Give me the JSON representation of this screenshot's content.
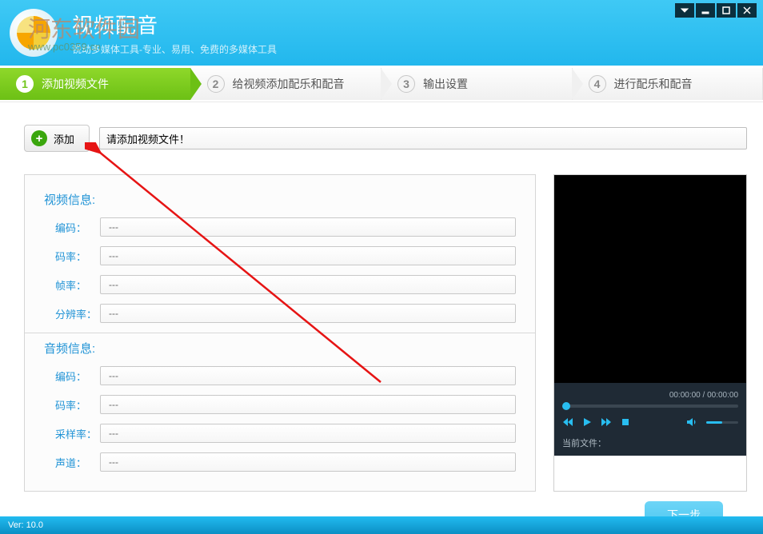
{
  "watermark": {
    "text": "河东软件园",
    "url": "www.pc0359.cn"
  },
  "header": {
    "title": "视频配音",
    "subtitle": "锐动多媒体工具-专业、易用、免费的多媒体工具"
  },
  "steps": [
    {
      "num": "1",
      "label": "添加视频文件",
      "active": true
    },
    {
      "num": "2",
      "label": "给视频添加配乐和配音",
      "active": false
    },
    {
      "num": "3",
      "label": "输出设置",
      "active": false
    },
    {
      "num": "4",
      "label": "进行配乐和配音",
      "active": false
    }
  ],
  "add": {
    "button": "添加",
    "placeholder": "请添加视频文件！"
  },
  "video_info": {
    "title": "视频信息:",
    "fields": [
      {
        "label": "编码：",
        "value": "---"
      },
      {
        "label": "码率：",
        "value": "---"
      },
      {
        "label": "帧率：",
        "value": "---"
      },
      {
        "label": "分辨率：",
        "value": "---"
      }
    ]
  },
  "audio_info": {
    "title": "音频信息:",
    "fields": [
      {
        "label": "编码：",
        "value": "---"
      },
      {
        "label": "码率：",
        "value": "---"
      },
      {
        "label": "采样率：",
        "value": "---"
      },
      {
        "label": "声道：",
        "value": "---"
      }
    ]
  },
  "preview": {
    "time": "00:00:00 / 00:00:00",
    "current_label": "当前文件："
  },
  "next_button": "下一步",
  "footer": {
    "version": "Ver: 10.0"
  }
}
